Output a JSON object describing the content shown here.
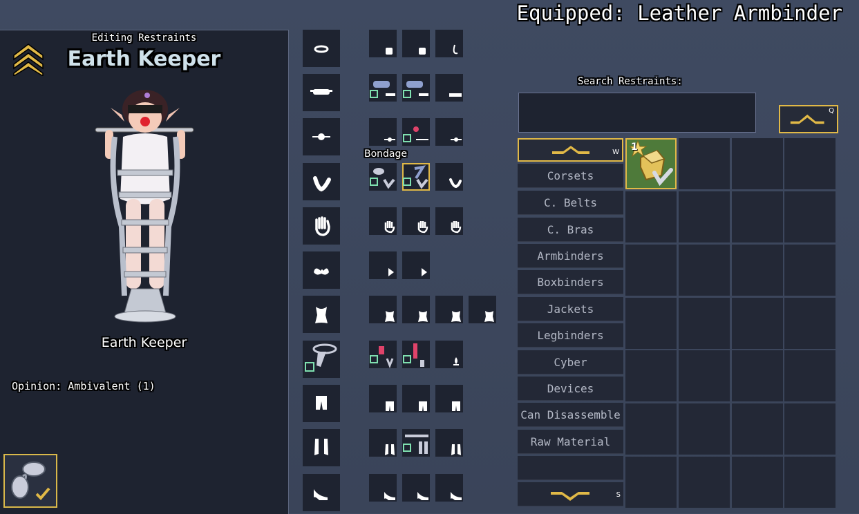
{
  "header": {
    "equipped_text": "Equipped: Leather Armbinder"
  },
  "character": {
    "editing_label": "Editing Restraints",
    "name_title": "Earth Keeper",
    "name_sub": "Earth Keeper",
    "opinion": "Opinion: Ambivalent (1)"
  },
  "slots": {
    "bondage_label": "Bondage"
  },
  "search": {
    "label": "Search Restraints:",
    "value": "",
    "button_hotkey": "Q"
  },
  "categories": {
    "up_hotkey": "W",
    "down_hotkey": "S",
    "items": [
      "Corsets",
      "C. Belts",
      "C. Bras",
      "Armbinders",
      "Boxbinders",
      "Jackets",
      "Legbinders",
      "Cyber",
      "Devices",
      "Can Disassemble",
      "Raw Material",
      ""
    ]
  },
  "inventory": {
    "first_item_count": "1"
  },
  "colors": {
    "accent": "#e1b947",
    "panel": "#1e2330",
    "selected_cell": "#4e7a3a"
  }
}
